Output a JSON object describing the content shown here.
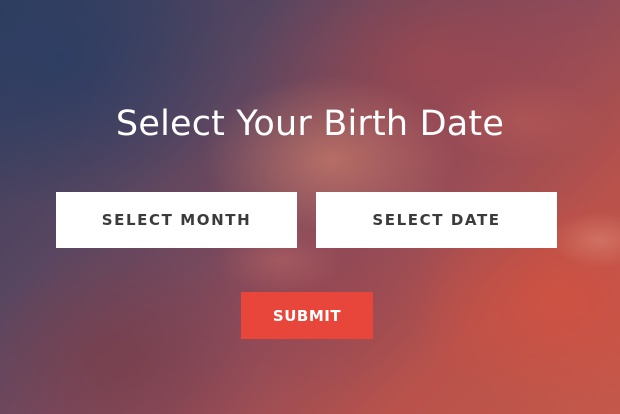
{
  "form": {
    "title": "Select Your Birth Date",
    "month_label": "SELECT MONTH",
    "date_label": "SELECT DATE",
    "submit_label": "SUBMIT"
  },
  "colors": {
    "submit_background": "#e8463a",
    "select_background": "#ffffff",
    "select_text": "#3b3b3b"
  }
}
